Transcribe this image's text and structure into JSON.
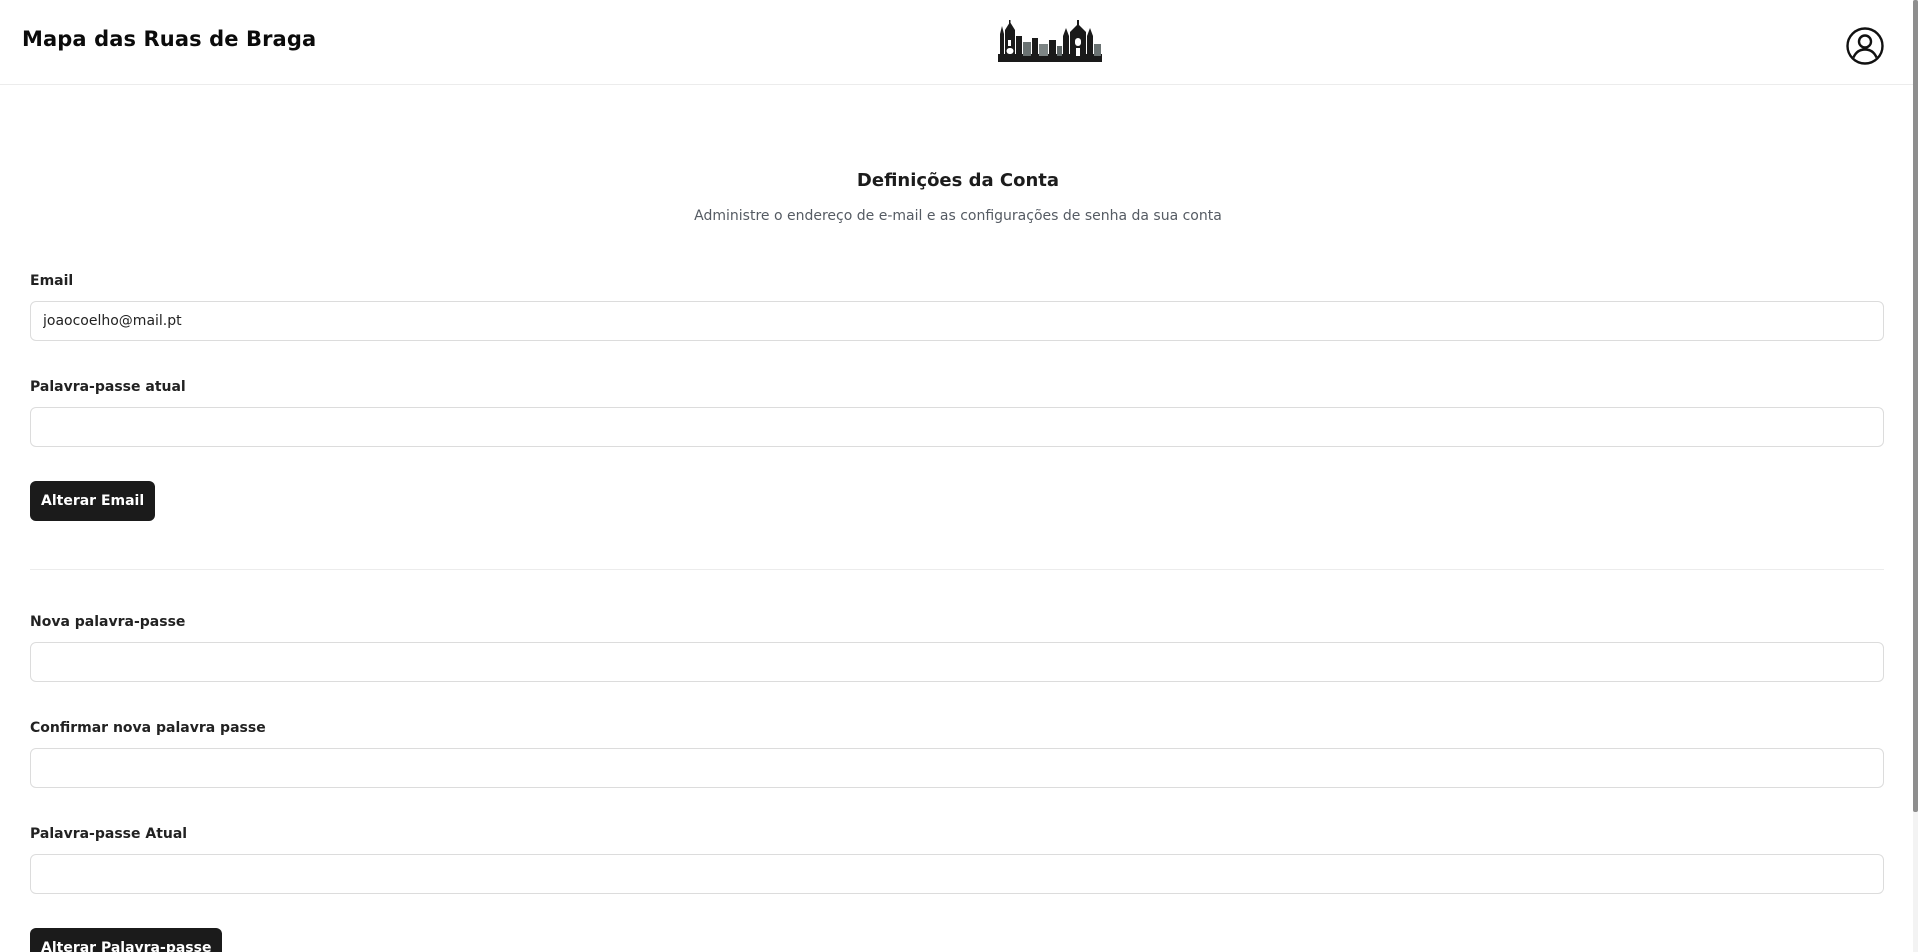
{
  "header": {
    "title": "Mapa das Ruas de Braga",
    "logo_icon": "braga-skyline-logo",
    "account_icon": "user-circle-icon"
  },
  "settings": {
    "title": "Definições da Conta",
    "subtitle": "Administre o endereço de e-mail e as configurações de senha da sua conta",
    "email_section": {
      "email_label": "Email",
      "email_value": "joaocoelho@mail.pt",
      "current_password_label": "Palavra-passe atual",
      "current_password_value": "",
      "submit_label": "Alterar Email"
    },
    "password_section": {
      "new_password_label": "Nova palavra-passe",
      "new_password_value": "",
      "confirm_password_label": "Confirmar nova palavra passe",
      "confirm_password_value": "",
      "current_password_label": "Palavra-passe Atual",
      "current_password_value": "",
      "submit_label": "Alterar Palavra-passe"
    }
  },
  "colors": {
    "button_bg": "#1b1b1b",
    "button_text": "#ffffff",
    "input_border": "#dcdcdc",
    "subtitle_text": "#555b63"
  }
}
